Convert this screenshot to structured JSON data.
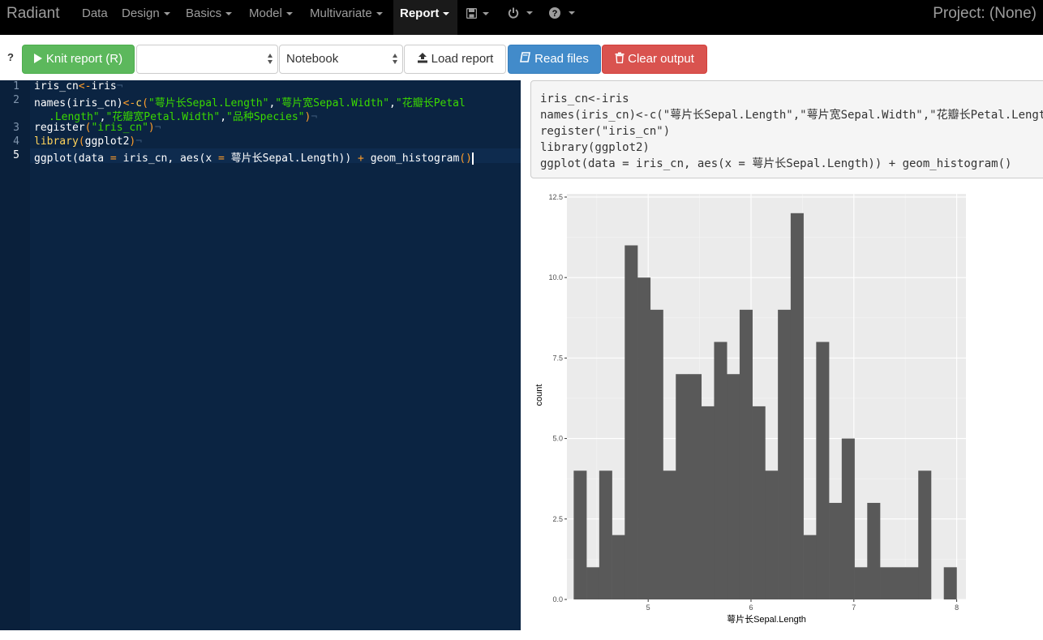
{
  "navbar": {
    "brand": "Radiant",
    "items": [
      {
        "label": "Data",
        "caret": false
      },
      {
        "label": "Design",
        "caret": true
      },
      {
        "label": "Basics",
        "caret": true
      },
      {
        "label": "Model",
        "caret": true
      },
      {
        "label": "Multivariate",
        "caret": true
      },
      {
        "label": "Report",
        "caret": true,
        "active": true
      }
    ],
    "icons": [
      "save-icon",
      "power-icon",
      "question-circle-icon"
    ],
    "project": "Project: (None)"
  },
  "toolbar": {
    "help": "?",
    "knit_label": "Knit report (R)",
    "select1_value": "",
    "select2_value": "Notebook",
    "load_label": "Load report",
    "read_label": "Read files",
    "clear_label": "Clear output"
  },
  "editor": {
    "line_numbers": [
      "1",
      "2",
      "",
      "3",
      "4",
      "5"
    ]
  },
  "output": {
    "code": "iris_cn<-iris\nnames(iris_cn)<-c(\"萼片长Sepal.Length\",\"萼片宽Sepal.Width\",\"花瓣长Petal.Length\",\"花瓣宽Petal.Width\",\"品种Species\")\nregister(\"iris_cn\")\nlibrary(ggplot2)\nggplot(data = iris_cn, aes(x = 萼片长Sepal.Length)) + geom_histogram()"
  },
  "chart_data": {
    "type": "bar",
    "xlabel": "萼片长Sepal.Length",
    "ylabel": "count",
    "xlim": [
      4.21,
      8.09
    ],
    "ylim": [
      0,
      12.6
    ],
    "x_ticks": [
      "5",
      "6",
      "7",
      "8"
    ],
    "y_ticks": [
      "0.0",
      "2.5",
      "5.0",
      "7.5",
      "10.0",
      "12.5"
    ],
    "bin_start": 4.2759,
    "bin_width": 0.1241,
    "values": [
      4,
      1,
      4,
      2,
      11,
      10,
      9,
      4,
      7,
      7,
      6,
      8,
      7,
      9,
      6,
      4,
      9,
      12,
      2,
      8,
      3,
      5,
      1,
      3,
      1,
      1,
      1,
      4,
      0,
      1
    ],
    "bar_color": "#595959",
    "panel_color": "#ebebeb",
    "grid": true
  }
}
